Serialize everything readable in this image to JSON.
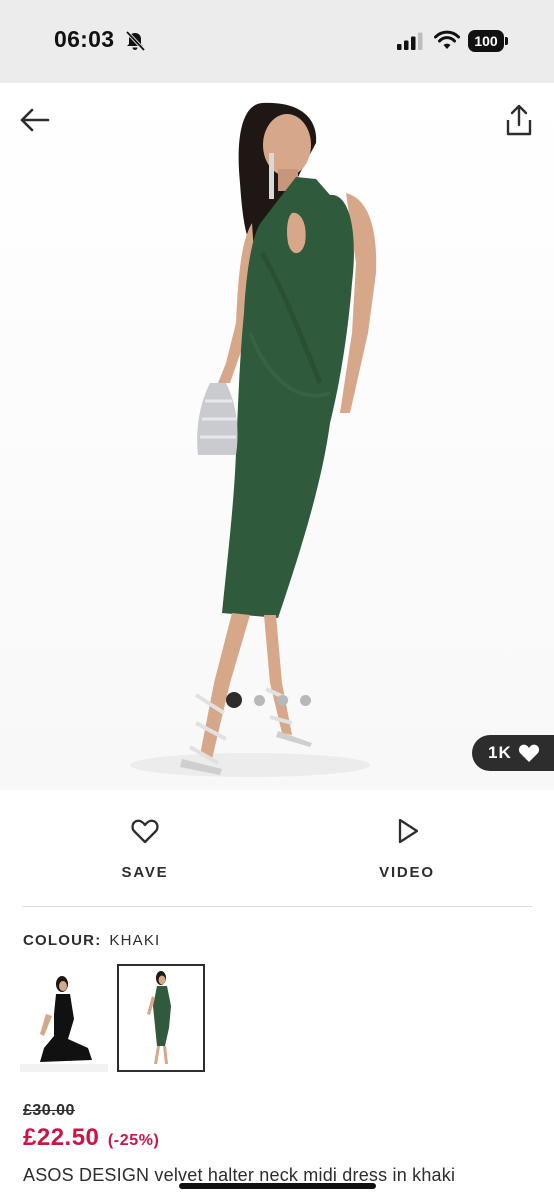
{
  "status_bar": {
    "time": "06:03",
    "battery": "100",
    "icons": [
      "bell-slash-icon",
      "signal-icon",
      "wifi-icon",
      "battery-icon"
    ]
  },
  "hero": {
    "image_subject": "model-green-velvet-dress",
    "icons": [
      "arrow-left-icon",
      "share-icon",
      "heart-icon"
    ],
    "carousel": {
      "count": 4,
      "active_index": 0
    },
    "likes": "1K"
  },
  "actions": {
    "save_label": "SAVE",
    "video_label": "VIDEO"
  },
  "colour": {
    "label": "COLOUR:",
    "value": "KHAKI",
    "swatches": [
      "black",
      "khaki"
    ],
    "selected_index": 1
  },
  "price": {
    "old": "£30.00",
    "current": "£22.50",
    "discount": "(-25%)"
  },
  "product": {
    "title": "ASOS DESIGN velvet halter neck midi dress in khaki"
  },
  "colors": {
    "sale_red": "#d01345",
    "text_dark": "#2d2d2d",
    "dress_green": "#2f5a3c",
    "status_bar_bg": "#ececec"
  }
}
